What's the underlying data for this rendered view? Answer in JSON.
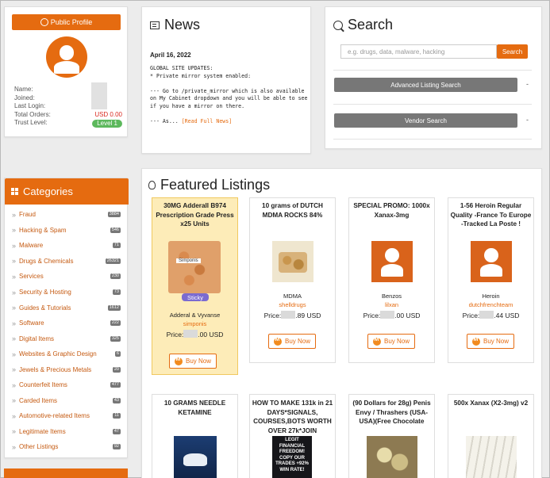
{
  "profile": {
    "button_label": "Public Profile",
    "rows": [
      {
        "label": "Name:",
        "value": ""
      },
      {
        "label": "Joined:",
        "value": ""
      },
      {
        "label": "Last Login:",
        "value": ""
      },
      {
        "label": "Total Orders:",
        "value": "USD 0.00"
      },
      {
        "label": "Trust Level:",
        "value": "Level 1"
      }
    ]
  },
  "news": {
    "title": "News",
    "date": "April 16, 2022",
    "body": "GLOBAL SITE UPDATES:\n* Private mirror system enabled:\n\n--- Go to /private_mirror which is also available on My Cabinet dropdown and you will be able to see if you have a mirror on there.\n\n--- As... ",
    "read_more": "[Read Full News]"
  },
  "search": {
    "title": "Search",
    "placeholder": "e.g. drugs, data, malware, hacking",
    "button": "Search",
    "advanced": "Advanced Listing Search",
    "vendor": "Vendor Search",
    "caret": "-"
  },
  "categories": {
    "title": "Categories",
    "items": [
      {
        "label": "Fraud",
        "count": "3884"
      },
      {
        "label": "Hacking & Spam",
        "count": "546"
      },
      {
        "label": "Malware",
        "count": "71"
      },
      {
        "label": "Drugs & Chemicals",
        "count": "26321"
      },
      {
        "label": "Services",
        "count": "230"
      },
      {
        "label": "Security & Hosting",
        "count": "73"
      },
      {
        "label": "Guides & Tutorials",
        "count": "1612"
      },
      {
        "label": "Software",
        "count": "222"
      },
      {
        "label": "Digital Items",
        "count": "325"
      },
      {
        "label": "Websites & Graphic Design",
        "count": "6"
      },
      {
        "label": "Jewels & Precious Metals",
        "count": "20"
      },
      {
        "label": "Counterfeit Items",
        "count": "477"
      },
      {
        "label": "Carded Items",
        "count": "43"
      },
      {
        "label": "Automotive-related Items",
        "count": "11"
      },
      {
        "label": "Legitimate Items",
        "count": "47"
      },
      {
        "label": "Other Listings",
        "count": "92"
      }
    ]
  },
  "featured": {
    "title": "Featured Listings",
    "buy_label": "Buy Now",
    "cards": [
      {
        "title": "30MG Adderall B974 Prescription Grade Press x25 Units",
        "badge": "Sticky",
        "img_label": "Simponis",
        "name": "Adderal & Vyvanse",
        "seller": "simponis",
        "price_prefix": "Price:",
        "price_suffix": ".00 USD"
      },
      {
        "title": "10 grams of DUTCH MDMA ROCKS 84%",
        "name": "MDMA",
        "seller": "shelldrugs",
        "price_prefix": "Price:",
        "price_suffix": ".89 USD"
      },
      {
        "title": "SPECIAL PROMO: 1000x Xanax-3mg",
        "name": "Benzos",
        "seller": "lilxan",
        "price_prefix": "Price:",
        "price_suffix": ".00 USD"
      },
      {
        "title": "1-56 Heroin Regular Quality -France To Europe -Tracked La Poste !",
        "name": "Heroin",
        "seller": "dutchfrenchteam",
        "price_prefix": "Price:",
        "price_suffix": ".44 USD"
      },
      {
        "title": "10 GRAMS NEEDLE KETAMINE"
      },
      {
        "title": "HOW TO MAKE 131k in 21 DAYS*SIGNALS, COURSES,BOTS WORTH OVER 27k*JOIN",
        "img_text": "LEGIT FINANCIAL FREEDOM! COPY OUR TRADES +92% WIN RATE!"
      },
      {
        "title": "(90 Dollars for 28g) Penis Envy / Thrashers (USA-USA)(Free Chocolate"
      },
      {
        "title": "500x Xanax (X2-3mg) v2"
      }
    ]
  },
  "colors": {
    "accent": "#e56b10",
    "sticky_bg": "#fdecb8",
    "sticky_badge": "#7b6bd0",
    "level_badge": "#5cb85c"
  }
}
